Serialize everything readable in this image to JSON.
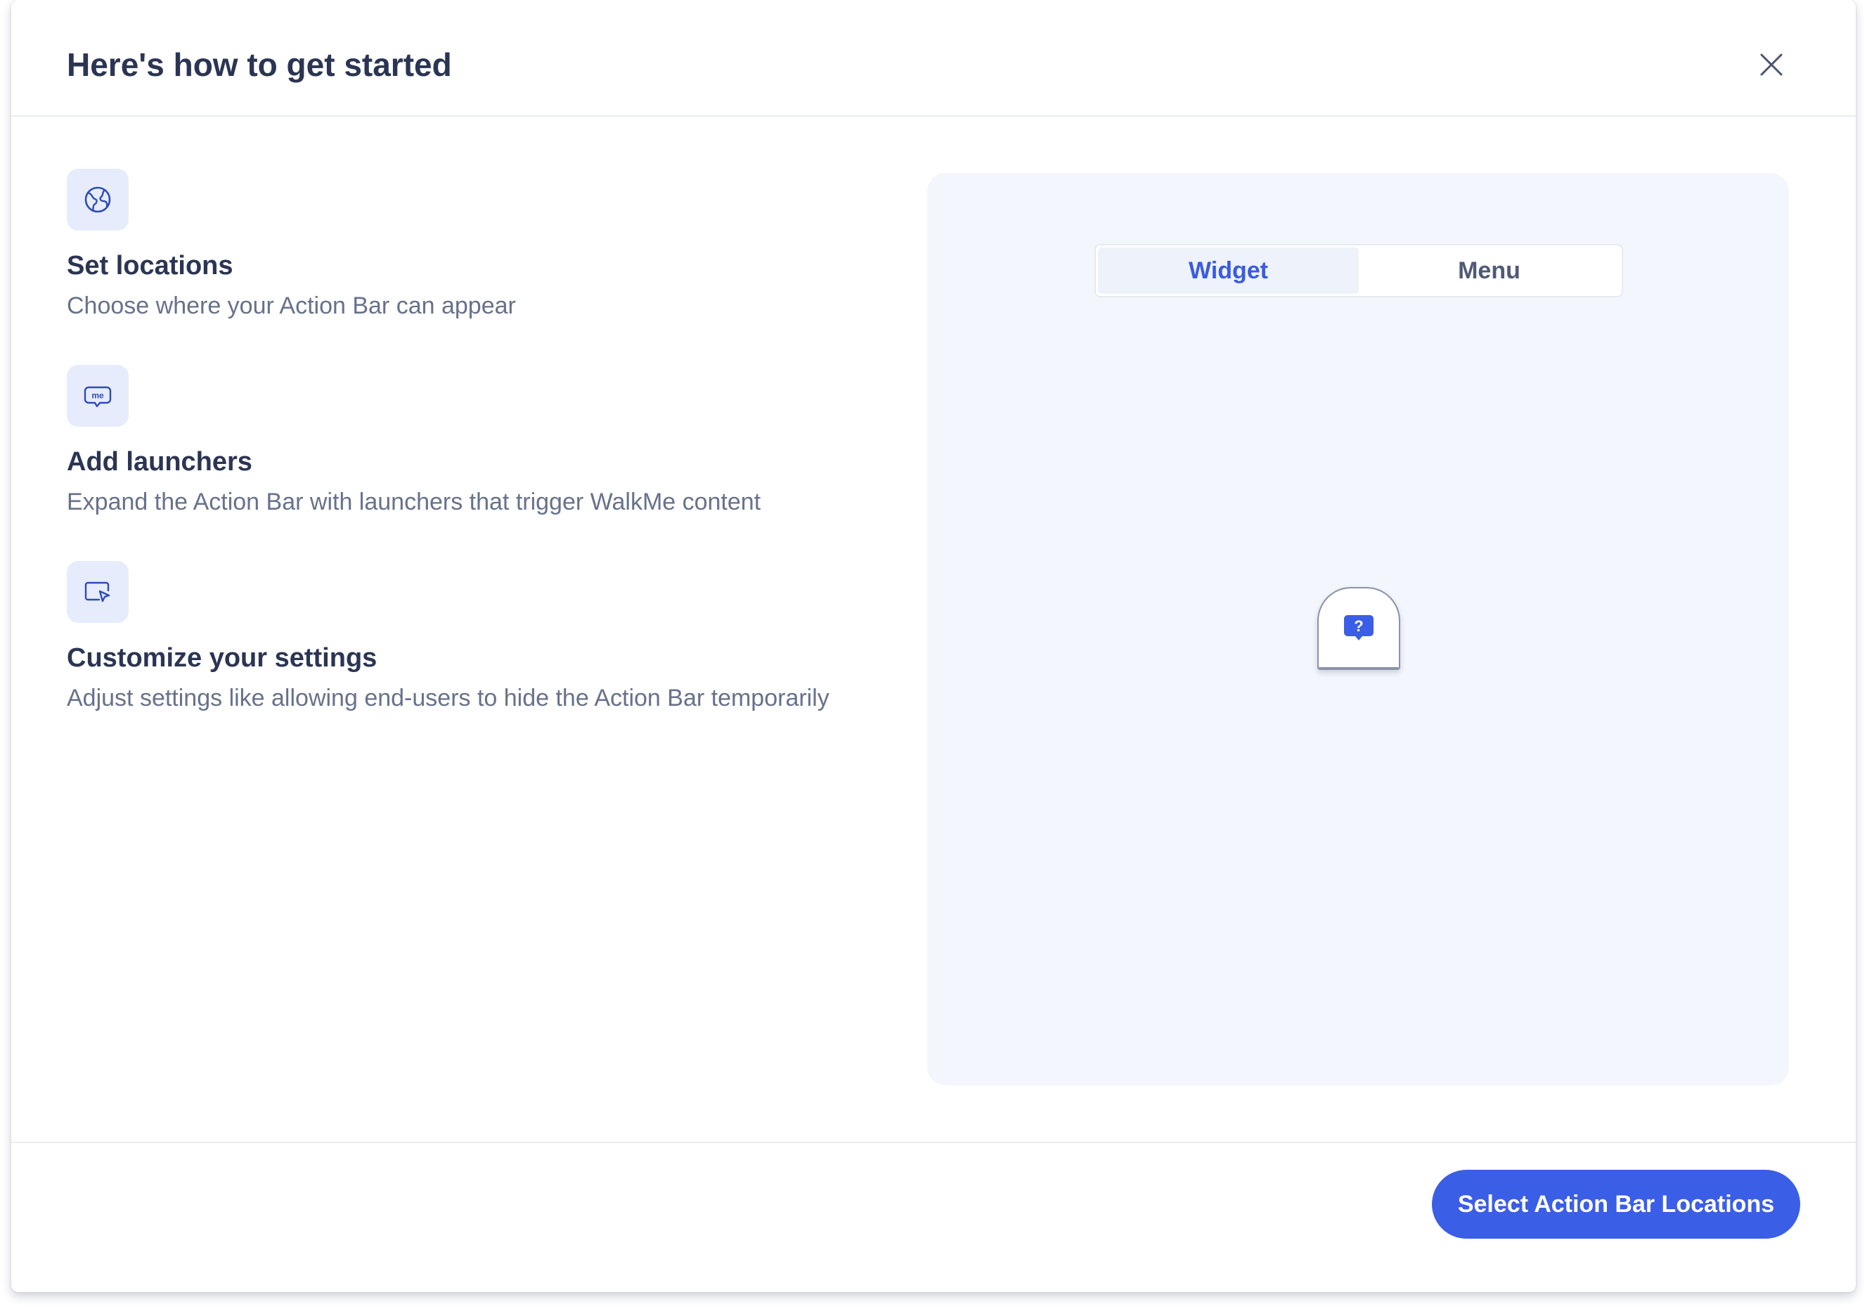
{
  "dialog": {
    "title": "Here's how to get started",
    "close_icon": "close-icon"
  },
  "steps": [
    {
      "icon": "globe-icon",
      "title": "Set locations",
      "description": "Choose where your Action Bar can appear"
    },
    {
      "icon": "me-chat-icon",
      "title": "Add launchers",
      "description": "Expand the Action Bar with launchers that trigger WalkMe content"
    },
    {
      "icon": "screen-cursor-icon",
      "title": "Customize your settings",
      "description": "Adjust settings like allowing end-users to hide the Action Bar temporarily"
    }
  ],
  "preview": {
    "tabs": [
      {
        "label": "Widget",
        "active": true
      },
      {
        "label": "Menu",
        "active": false
      }
    ],
    "launcher_icon": "question-bubble-icon"
  },
  "footer": {
    "primary_button": "Select Action Bar Locations"
  },
  "colors": {
    "accent": "#3b5ee6",
    "heading": "#2b3553",
    "body_text": "#67718a",
    "icon_tile": "#e6ecfb",
    "preview_bg": "#f3f6fc"
  }
}
